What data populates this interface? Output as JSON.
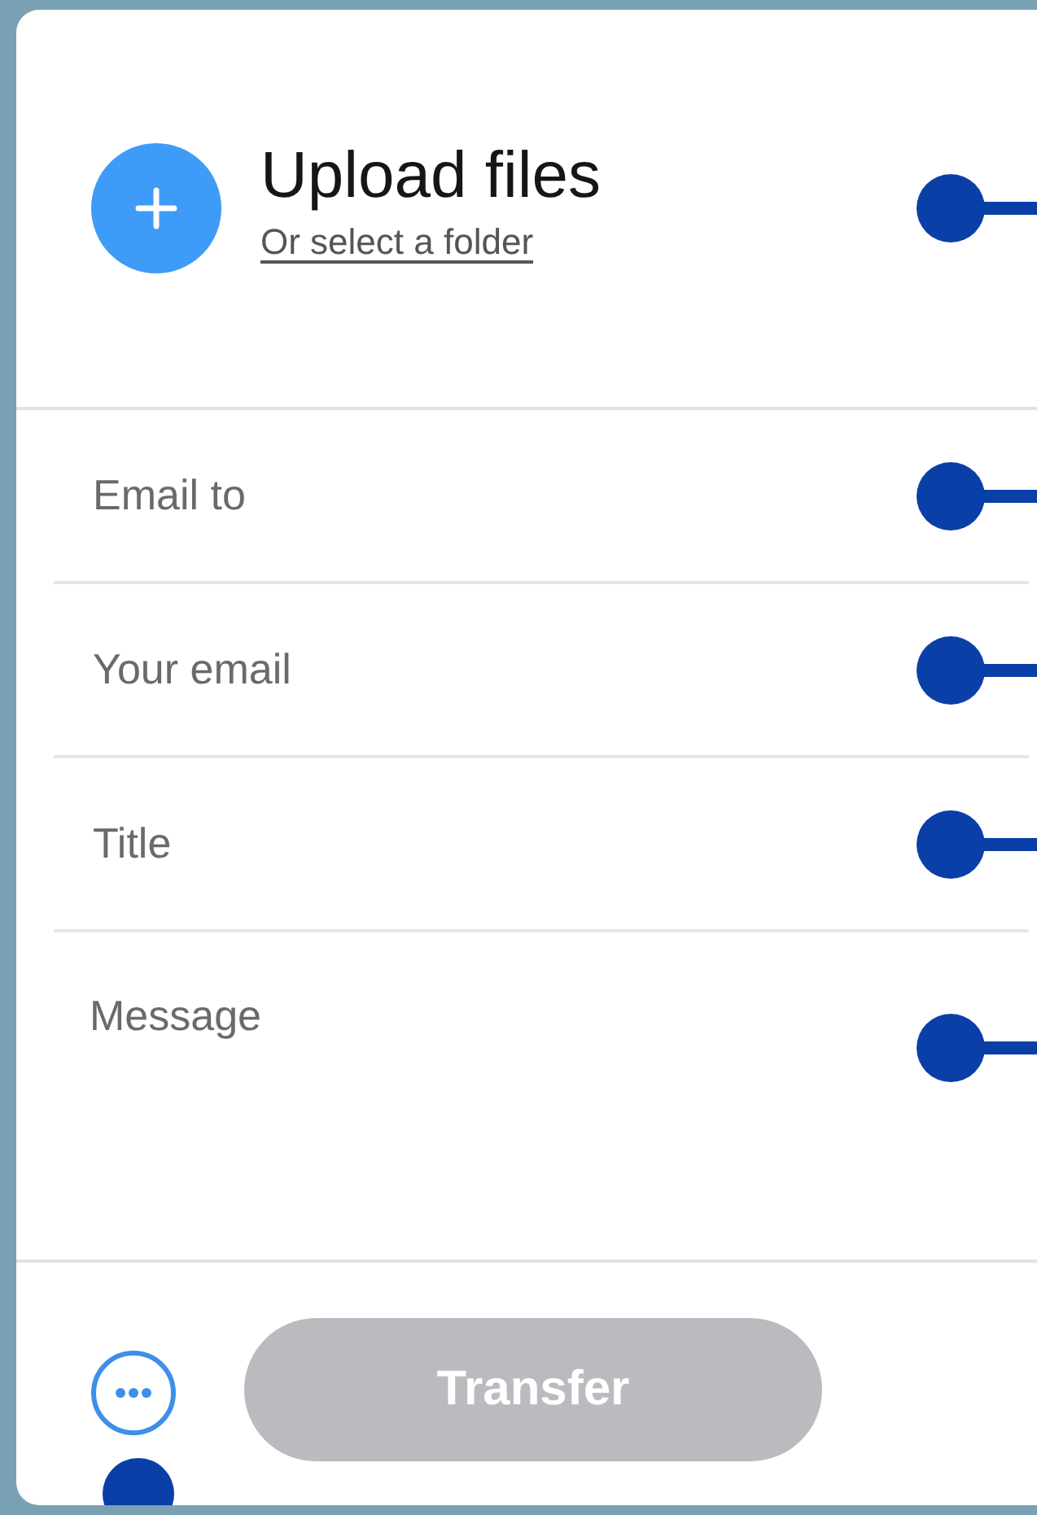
{
  "upload": {
    "title": "Upload files",
    "link": "Or select a folder"
  },
  "fields": [
    {
      "placeholder": "Email to",
      "kind": "line"
    },
    {
      "placeholder": "Your email",
      "kind": "line"
    },
    {
      "placeholder": "Title",
      "kind": "line"
    },
    {
      "placeholder": "Message",
      "kind": "textarea"
    }
  ],
  "transfer_button": {
    "label": "Transfer",
    "disabled": true
  }
}
